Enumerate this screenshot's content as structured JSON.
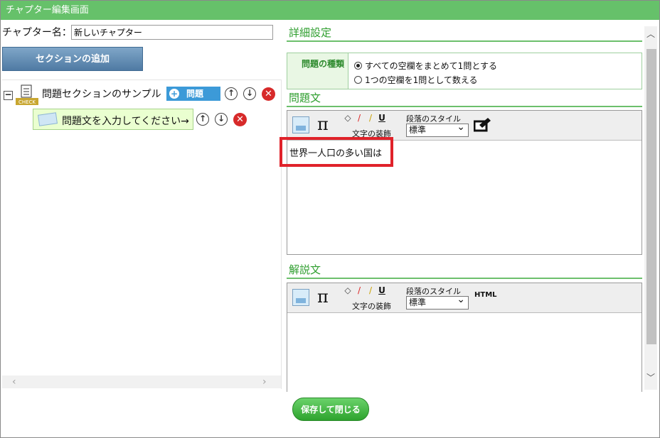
{
  "window": {
    "title": "チャプター編集画面"
  },
  "chapter": {
    "name_label": "チャプター名：",
    "name_value": "新しいチャプター"
  },
  "left": {
    "add_section_label": "セクションの追加",
    "collapse_symbol": "−",
    "check_icon_text": "CHECK",
    "section": {
      "label": "問題セクションのサンプル",
      "problem_button_label": "問題"
    },
    "item": {
      "label": "問題文を入力してください→"
    }
  },
  "right": {
    "details_title": "詳細設定",
    "problem_type_label": "問題の種類",
    "radio_options": [
      "すべての空欄をまとめて1問とする",
      "1つの空欄を1問として数える"
    ],
    "question_title": "問題文",
    "question_text": "世界一人口の多い国は",
    "explanation_title": "解説文",
    "toolbar": {
      "pi_symbol": "π",
      "decoration_label": "文字の装飾",
      "paragraph_style_label": "段落のスタイル",
      "paragraph_style_value": "標準",
      "html_label": "HTML"
    }
  },
  "footer": {
    "save_label": "保存して閉じる"
  },
  "colors": {
    "titlebar": "#66c16a",
    "section_title": "#2e9e2e",
    "highlight": "#e0222a"
  }
}
